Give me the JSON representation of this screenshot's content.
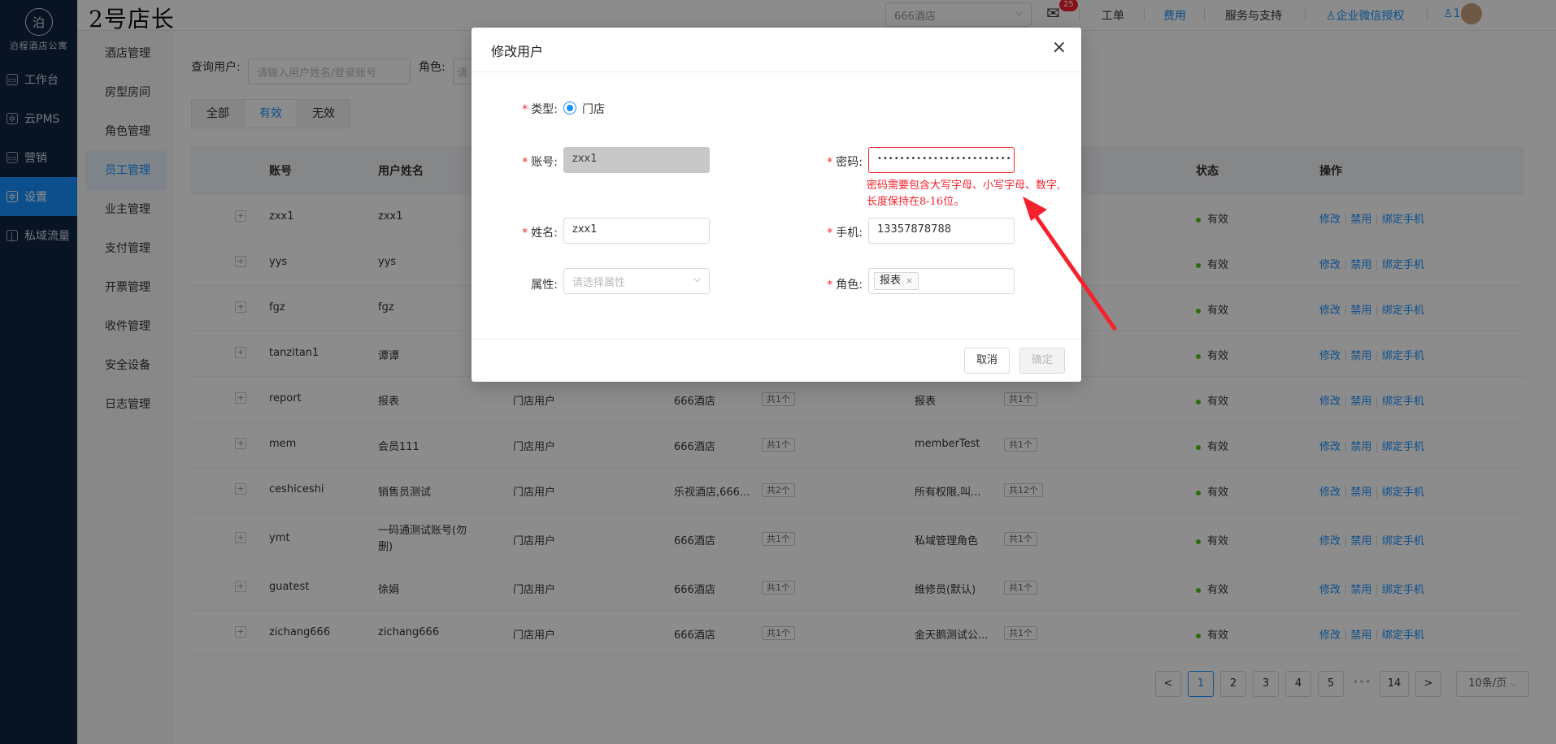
{
  "brand": {
    "logo_text": "泊程酒店公寓",
    "app_title": "2号店长"
  },
  "nav": [
    {
      "label": "工作台",
      "active": false
    },
    {
      "label": "云PMS",
      "active": false
    },
    {
      "label": "营销",
      "active": false
    },
    {
      "label": "设置",
      "active": true
    },
    {
      "label": "私域流量",
      "active": false
    }
  ],
  "submenu": [
    "酒店管理",
    "房型房间",
    "角色管理",
    "员工管理",
    "业主管理",
    "支付管理",
    "开票管理",
    "收件管理",
    "安全设备",
    "日志管理"
  ],
  "header": {
    "store_select": "666酒店",
    "mail_badge": "25",
    "links": [
      "工单",
      "费用",
      "服务与支持",
      "企业微信授权",
      "1"
    ]
  },
  "query": {
    "label": "查询用户:",
    "placeholder": "请输入用户姓名/登录账号",
    "role_label": "角色:",
    "role_placeholder": "请"
  },
  "tabs": [
    "全部",
    "有效",
    "无效"
  ],
  "table": {
    "columns": [
      "账号",
      "用户姓名",
      "状态",
      "操作"
    ],
    "rows": [
      {
        "account": "zxx1",
        "name": "zxx1",
        "type": "",
        "hotel": "",
        "hotel_count": "",
        "role": "",
        "role_count": "",
        "status": "有效"
      },
      {
        "account": "yys",
        "name": "yys",
        "type": "",
        "hotel": "",
        "hotel_count": "",
        "role": "",
        "role_count": "",
        "status": "有效"
      },
      {
        "account": "fgz",
        "name": "fgz",
        "type": "",
        "hotel": "",
        "hotel_count": "",
        "role": "",
        "role_count": "",
        "status": "有效"
      },
      {
        "account": "tanzitan1",
        "name": "谭谭",
        "type": "",
        "hotel": "",
        "hotel_count": "",
        "role": "",
        "role_count": "",
        "status": "有效"
      },
      {
        "account": "report",
        "name": "报表",
        "type": "门店用户",
        "hotel": "666酒店",
        "hotel_count": "共1个",
        "role": "报表",
        "role_count": "共1个",
        "status": "有效"
      },
      {
        "account": "mem",
        "name": "会员111",
        "type": "门店用户",
        "hotel": "666酒店",
        "hotel_count": "共1个",
        "role": "memberTest",
        "role_count": "共1个",
        "status": "有效"
      },
      {
        "account": "ceshiceshi",
        "name": "销售员测试",
        "type": "门店用户",
        "hotel": "乐视酒店,666...",
        "hotel_count": "共2个",
        "role": "所有权限,叫...",
        "role_count": "共12个",
        "status": "有效"
      },
      {
        "account": "ymt",
        "name": "一码通测试账号(勿删)",
        "type": "门店用户",
        "hotel": "666酒店",
        "hotel_count": "共1个",
        "role": "私域管理角色",
        "role_count": "共1个",
        "status": "有效"
      },
      {
        "account": "guatest",
        "name": "徐娟",
        "type": "门店用户",
        "hotel": "666酒店",
        "hotel_count": "共1个",
        "role": "维修员(默认)",
        "role_count": "共1个",
        "status": "有效"
      },
      {
        "account": "zichang666",
        "name": "zichang666",
        "type": "门店用户",
        "hotel": "666酒店",
        "hotel_count": "共1个",
        "role": "金天鹅测试公...",
        "role_count": "共1个",
        "status": "有效"
      }
    ],
    "ops": [
      "修改",
      "禁用",
      "绑定手机"
    ]
  },
  "pagination": {
    "prev": "<",
    "pages": [
      "1",
      "2",
      "3",
      "4",
      "5",
      "•••",
      "14"
    ],
    "next": ">",
    "size": "10条/页",
    "current": "1"
  },
  "modal": {
    "title": "修改用户",
    "close": "×",
    "type_label": "类型:",
    "type_value": "门店",
    "account_label": "账号:",
    "account_value": "zxx1",
    "password_label": "密码:",
    "password_value": "••••••••••••••••••••••••",
    "password_error": "密码需要包含大写字母、小写字母、数字,长度保持在8-16位。",
    "name_label": "姓名:",
    "name_value": "zxx1",
    "phone_label": "手机:",
    "phone_value": "13357878788",
    "attr_label": "属性:",
    "attr_placeholder": "请选择属性",
    "role_label": "角色:",
    "role_tag": "报表",
    "cancel": "取消",
    "confirm": "确定"
  },
  "colors": {
    "primary": "#1890ff",
    "error": "#f5222d",
    "sidebar": "#0f2540",
    "annotation_arrow": "#f5222d"
  }
}
